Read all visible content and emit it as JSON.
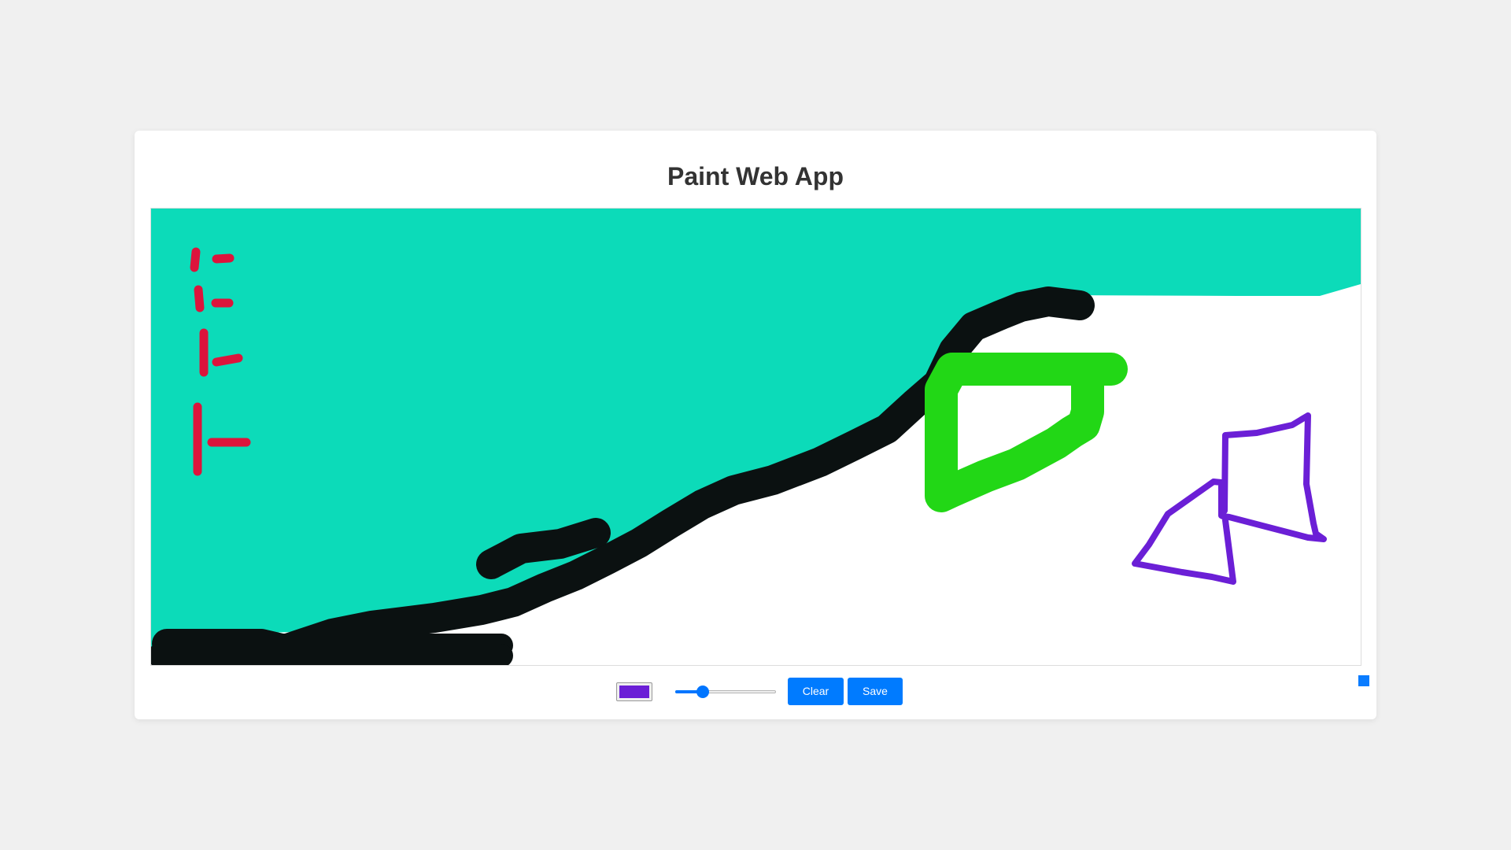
{
  "app": {
    "title": "Paint Web App"
  },
  "canvas": {
    "background_color": "#ffffff",
    "strokes": [
      {
        "name": "fill-region",
        "color": "#0cdbb9",
        "kind": "fill"
      },
      {
        "name": "black-stroke",
        "color": "#0b1111",
        "kind": "line"
      },
      {
        "name": "red-marks",
        "color": "#dc143c",
        "kind": "line"
      },
      {
        "name": "green-shape",
        "color": "#22d716",
        "kind": "line"
      },
      {
        "name": "purple-shape",
        "color": "#6b1fd6",
        "kind": "line"
      }
    ]
  },
  "toolbar": {
    "color_value": "#6b1fd6",
    "brush_size_fraction": 0.24,
    "clear_label": "Clear",
    "save_label": "Save",
    "accent_color": "#007bff"
  }
}
